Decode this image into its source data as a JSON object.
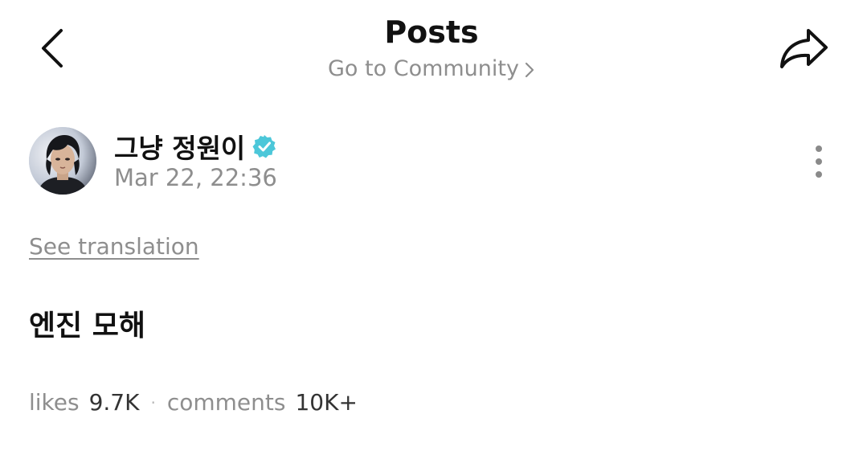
{
  "header": {
    "title": "Posts",
    "community_link": "Go to Community",
    "back_icon": "chevron-left-icon",
    "share_icon": "share-arrow-icon"
  },
  "author": {
    "name": "그냥 정원이",
    "verified": true,
    "timestamp": "Mar 22, 22:36",
    "verified_color": "#4cc7d9"
  },
  "post": {
    "translate_label": "See translation",
    "content": "엔진 모해"
  },
  "stats": {
    "likes_label": "likes",
    "likes_value": "9.7K",
    "separator": "·",
    "comments_label": "comments",
    "comments_value": "10K+"
  }
}
